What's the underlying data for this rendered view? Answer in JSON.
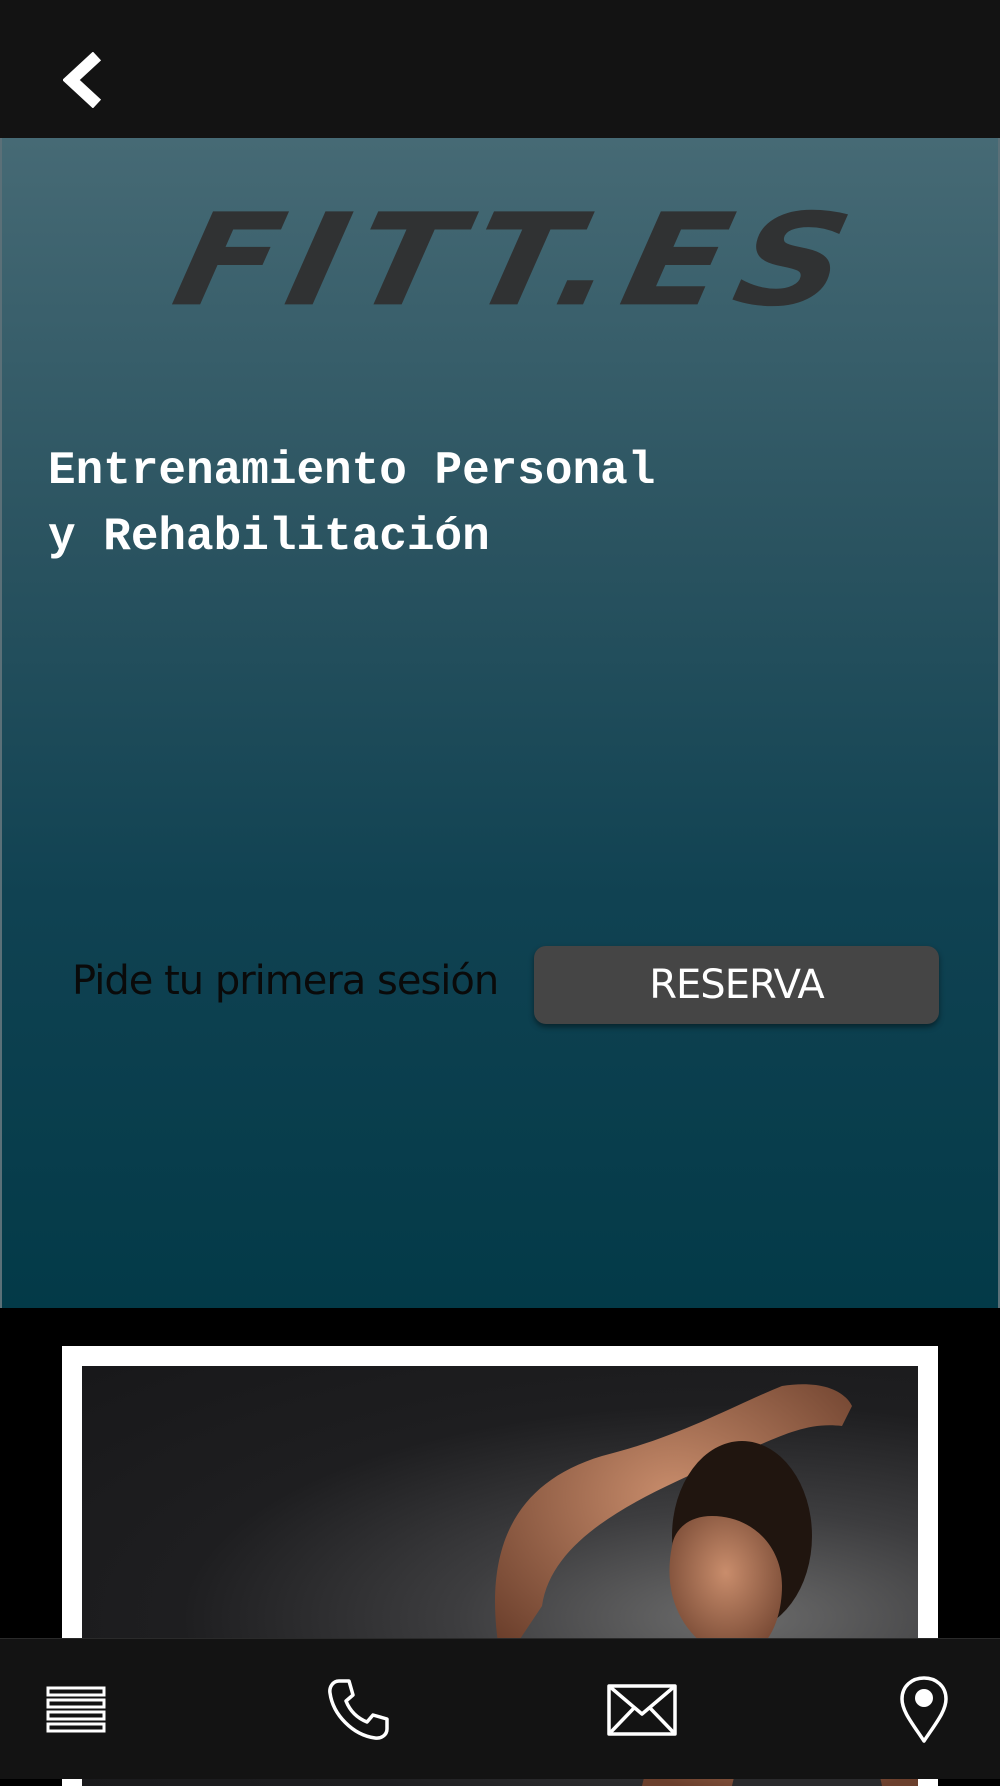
{
  "header": {
    "back_icon": "chevron-left-icon"
  },
  "hero": {
    "logo_text": "FITT.ES",
    "headline_line1": "Entrenamiento Personal",
    "headline_line2": "y Rehabilitación",
    "cta_text": "Pide tu primera sesión",
    "reserve_label": "RESERVA"
  },
  "bottom_nav": {
    "items": [
      {
        "icon": "menu-icon"
      },
      {
        "icon": "phone-icon"
      },
      {
        "icon": "mail-icon"
      },
      {
        "icon": "location-pin-icon"
      }
    ]
  },
  "colors": {
    "bar_background": "#131313",
    "hero_top": "#466a75",
    "hero_bottom": "#033a48",
    "button": "#454545"
  }
}
